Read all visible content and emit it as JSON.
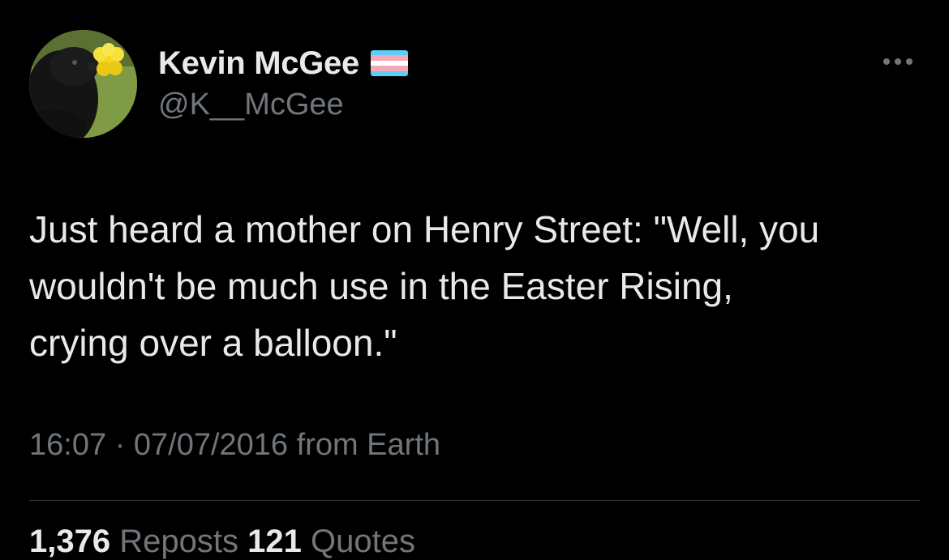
{
  "author": {
    "display_name": "Kevin McGee",
    "handle": "@K__McGee",
    "flag": {
      "icon": "transgender-flag-icon",
      "colors": [
        "#5bcefa",
        "#f5a9b8",
        "#ffffff",
        "#f5a9b8",
        "#5bcefa"
      ]
    },
    "avatar_icon": "crow-with-flower-avatar"
  },
  "more_icon": "more-options-icon",
  "tweet": {
    "lines": [
      "Just heard a mother on Henry Street: \"Well, you",
      "wouldn't be much use in the Easter Rising,",
      "crying over a balloon.\""
    ]
  },
  "meta": {
    "time": "16:07",
    "separator": "·",
    "date": "07/07/2016",
    "source": "from Earth"
  },
  "stats": {
    "reposts_count": "1,376",
    "reposts_label": "Reposts",
    "quotes_count": "121",
    "quotes_label": "Quotes"
  },
  "colors": {
    "background": "#000000",
    "text": "#e7e9ea",
    "secondary": "#71767b",
    "divider": "#2f3336"
  }
}
